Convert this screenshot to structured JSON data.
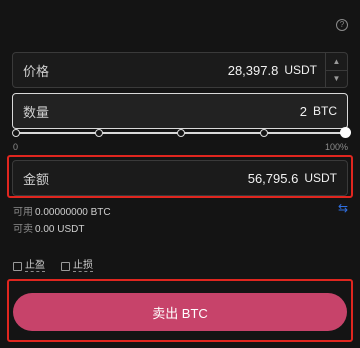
{
  "colors": {
    "background": "#141414",
    "sell_button": "#c7436a",
    "highlight": "#e0261f",
    "swap_icon": "#2f6fe0"
  },
  "price": {
    "label": "价格",
    "value": "28,397.8",
    "unit": "USDT"
  },
  "quantity": {
    "label": "数量",
    "value": "2",
    "unit": "BTC"
  },
  "slider": {
    "min_label": "0",
    "max_label": "100%",
    "level_percent": 100,
    "marks": [
      0,
      25,
      50,
      75,
      100
    ]
  },
  "amount": {
    "label": "金额",
    "value": "56,795.6",
    "unit": "USDT"
  },
  "available": {
    "label": "可用",
    "value": "0.00000000 BTC"
  },
  "sellable": {
    "label": "可卖",
    "value": "0.00 USDT"
  },
  "options": {
    "take_profit": "止盈",
    "stop_loss": "止损"
  },
  "sell_button_label": "卖出 BTC",
  "icons": {
    "help": "question-circle-icon",
    "swap": "swap-arrows-icon",
    "increment": "chevron-up-icon",
    "decrement": "chevron-down-icon"
  }
}
